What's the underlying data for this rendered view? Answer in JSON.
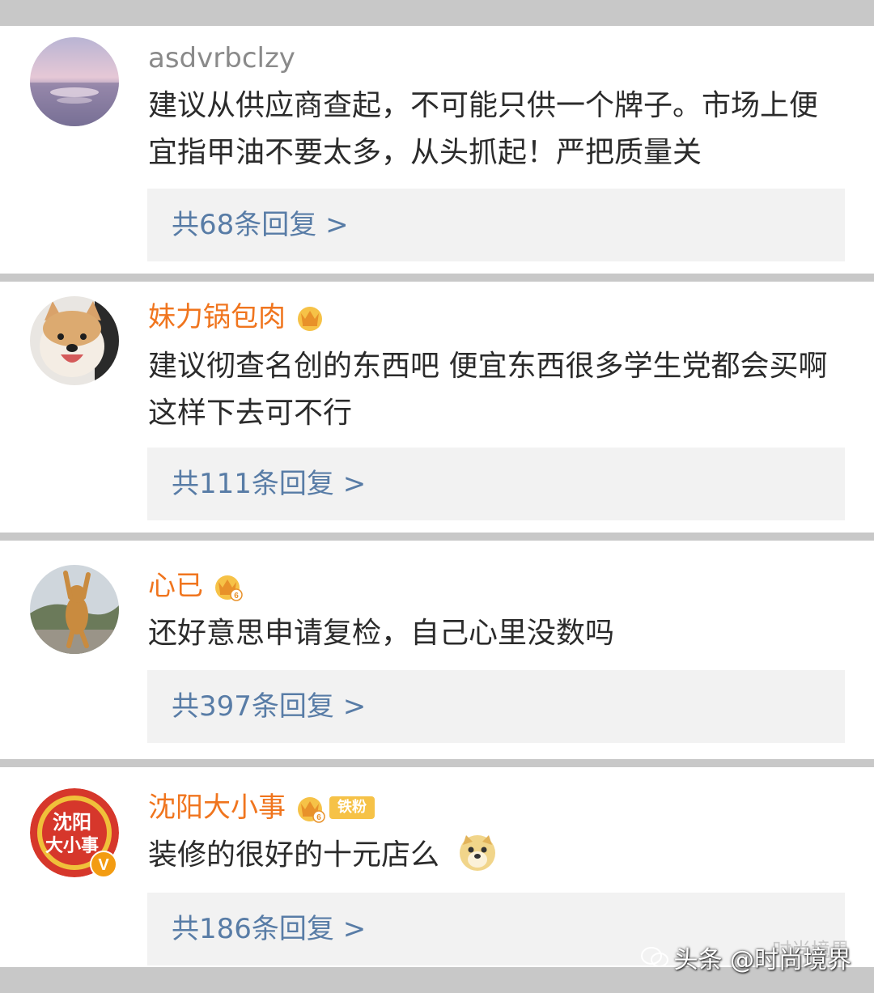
{
  "comments": [
    {
      "username": "asdvrbclzy",
      "text": "建议从供应商查起，不可能只供一个牌子。市场上便宜指甲油不要太多，从头抓起！严把质量关",
      "reply_label": "共68条回复 >",
      "avatar_icon": "sea-sunset-avatar"
    },
    {
      "username": "妹力锅包肉",
      "badge_icon": "crown-icon",
      "text": "建议彻查名创的东西吧 便宜东西很多学生党都会买啊 这样下去可不行",
      "reply_label": "共111条回复 >",
      "avatar_icon": "shiba-dog-avatar"
    },
    {
      "username": "心已",
      "badge_icon": "crown-level-6-icon",
      "badge_level": "6",
      "text": "还好意思申请复检，自己心里没数吗",
      "reply_label": "共397条回复 >",
      "avatar_icon": "dancing-cat-avatar"
    },
    {
      "username": "沈阳大小事",
      "badge_icon": "crown-level-6-icon",
      "badge_level": "6",
      "fan_tag": "铁粉",
      "text": "装修的很好的十元店么",
      "emoji_icon": "doge-emoji-icon",
      "reply_label": "共186条回复 >",
      "avatar_icon": "shenyang-logo-avatar",
      "avatar_text": "沈阳大小事",
      "verified_icon": "verified-v-icon",
      "verified_text": "V"
    }
  ],
  "watermark": {
    "text": "头条 @时尚境界",
    "ghost_text": "时尚境界",
    "icon": "wechat-icon"
  },
  "colors": {
    "username_plain": "#8a8a8a",
    "username_vip": "#f0751e",
    "reply_link": "#587ca6",
    "reply_bg": "#f2f2f2",
    "separator": "#c8c8c8"
  }
}
